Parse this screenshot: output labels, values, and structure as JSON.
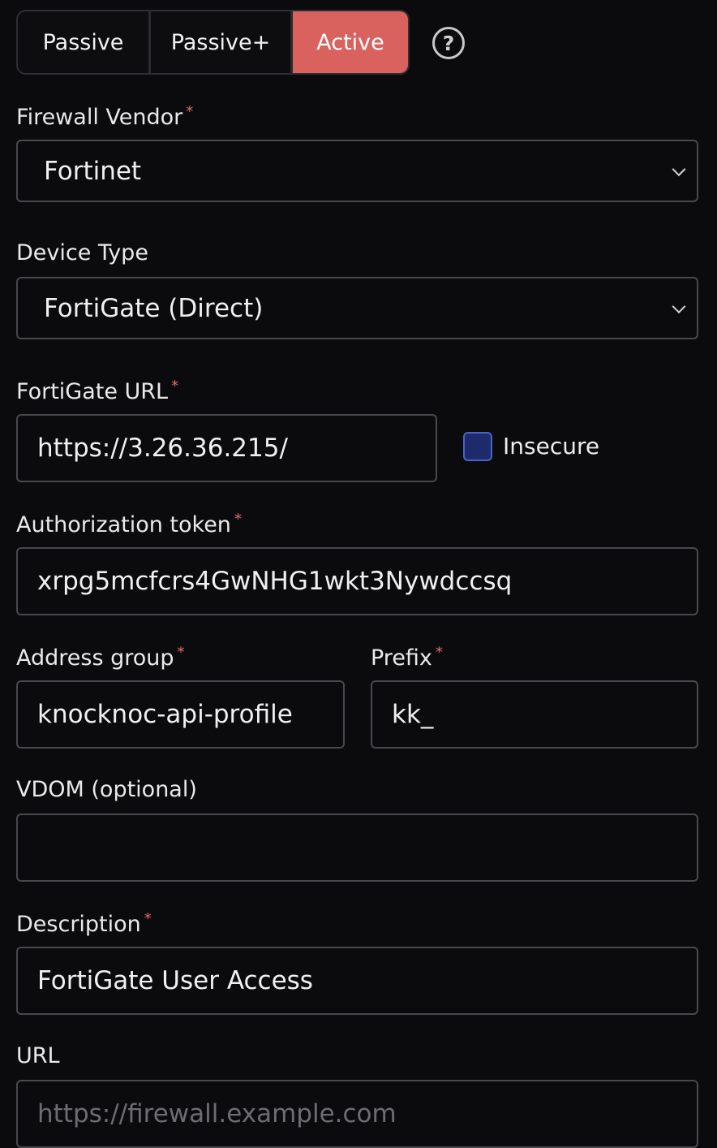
{
  "mode_toggle": {
    "options": [
      "Passive",
      "Passive+",
      "Active"
    ],
    "selected": "Active"
  },
  "help_icon": "?",
  "required_marker": "*",
  "firewall_vendor": {
    "label": "Firewall Vendor",
    "value": "Fortinet"
  },
  "device_type": {
    "label": "Device Type",
    "value": "FortiGate (Direct)"
  },
  "fortigate_url": {
    "label": "FortiGate URL",
    "value": "https://3.26.36.215/"
  },
  "insecure": {
    "label": "Insecure",
    "checked": false
  },
  "auth_token": {
    "label": "Authorization token",
    "value": "xrpg5mcfcrs4GwNHG1wkt3Nywdccsq"
  },
  "address_group": {
    "label": "Address group",
    "value": "knocknoc-api-profile"
  },
  "prefix": {
    "label": "Prefix",
    "value": "kk_"
  },
  "vdom": {
    "label": "VDOM (optional)",
    "value": ""
  },
  "description": {
    "label": "Description",
    "value": "FortiGate User Access"
  },
  "url": {
    "label": "URL",
    "placeholder": "https://firewall.example.com"
  },
  "colors": {
    "accent": "#d9625e",
    "checkbox": "#1d2a6c",
    "required": "#e26c69"
  }
}
